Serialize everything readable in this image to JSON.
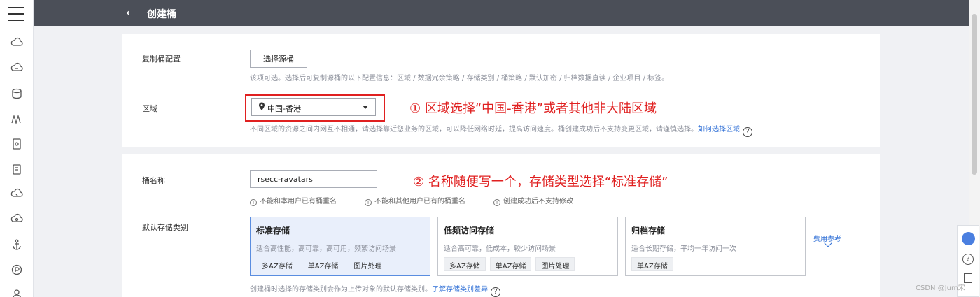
{
  "topbar": {
    "back_glyph": "‹",
    "title": "创建桶"
  },
  "replicate": {
    "label": "复制桶配置",
    "button": "选择源桶",
    "hint": "该项可选。选择后可复制源桶的以下配置信息：区域 / 数据冗余策略 / 存储类别 / 桶策略 / 默认加密 / 归档数据直读 / 企业项目 / 标签。"
  },
  "region": {
    "label": "区域",
    "selected": "中国-香港",
    "annotation": "① 区域选择“中国-香港”或者其他非大陆区域",
    "hint": "不同区域的资源之间内网互不相通，请选择靠近您业务的区域，可以降低网络时延，提高访问速度。桶创建成功后不支持变更区域，请谨慎选择。",
    "hint_link": "如何选择区域",
    "help_glyph": "?"
  },
  "bucket_name": {
    "label": "桶名称",
    "value": "rsecc-ravatars",
    "annotation": "② 名称随便写一个，存储类型选择“标准存储”",
    "rules": [
      "不能和本用户已有桶重名",
      "不能和其他用户已有的桶重名",
      "创建成功后不支持修改"
    ],
    "rule_icon": "!"
  },
  "storage_class": {
    "label": "默认存储类别",
    "options": [
      {
        "title": "标准存储",
        "desc": "适合高性能，高可靠，高可用，频繁访问场景",
        "tags": [
          "多AZ存储",
          "单AZ存储",
          "图片处理"
        ],
        "selected": true
      },
      {
        "title": "低频访问存储",
        "desc": "适合高可靠，低成本，较少访问场景",
        "tags": [
          "多AZ存储",
          "单AZ存储",
          "图片处理"
        ],
        "selected": false
      },
      {
        "title": "归档存储",
        "desc": "适合长期存储，平均一年访问一次",
        "tags": [
          "单AZ存储"
        ],
        "selected": false
      }
    ],
    "fee_link": "费用参考",
    "hint": "创建桶时选择的存储类别会作为上传对象的默认存储类别。",
    "hint_link": "了解存储类别差异",
    "help_glyph": "?"
  },
  "tools": {
    "help_glyph": "?"
  },
  "watermark": "CSDN @Jum宋",
  "colors": {
    "annotation": "#e02020",
    "link": "#2f6fd6",
    "topbar": "#4b4f58",
    "selected_border": "#5a8de0"
  }
}
